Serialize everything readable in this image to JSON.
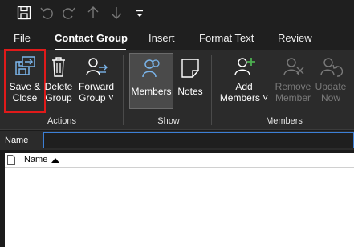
{
  "tabs": [
    {
      "label": "File"
    },
    {
      "label": "Contact Group"
    },
    {
      "label": "Insert"
    },
    {
      "label": "Format Text"
    },
    {
      "label": "Review"
    }
  ],
  "ribbon": {
    "actions": {
      "group_label": "Actions",
      "save_close": {
        "line1": "Save &",
        "line2": "Close"
      },
      "delete_group": {
        "line1": "Delete",
        "line2": "Group"
      },
      "forward_group": {
        "line1": "Forward",
        "line2": "Group ˅"
      }
    },
    "show": {
      "group_label": "Show",
      "members": {
        "label": "Members"
      },
      "notes": {
        "label": "Notes"
      }
    },
    "members": {
      "group_label": "Members",
      "add_members": {
        "line1": "Add",
        "line2": "Members ˅"
      },
      "remove_member": {
        "line1": "Remove",
        "line2": "Member"
      },
      "update_now": {
        "line1": "Update",
        "line2": "Now"
      }
    }
  },
  "name_field": {
    "label": "Name",
    "value": ""
  },
  "list": {
    "column_name": "Name"
  },
  "colors": {
    "accent": "#3c7fd6",
    "highlight_box": "#e01a1a",
    "add_plus": "#4caf50"
  },
  "icons": [
    "save-icon",
    "undo-icon",
    "redo-icon",
    "up-arrow-icon",
    "down-arrow-icon",
    "customize-qat-icon"
  ]
}
